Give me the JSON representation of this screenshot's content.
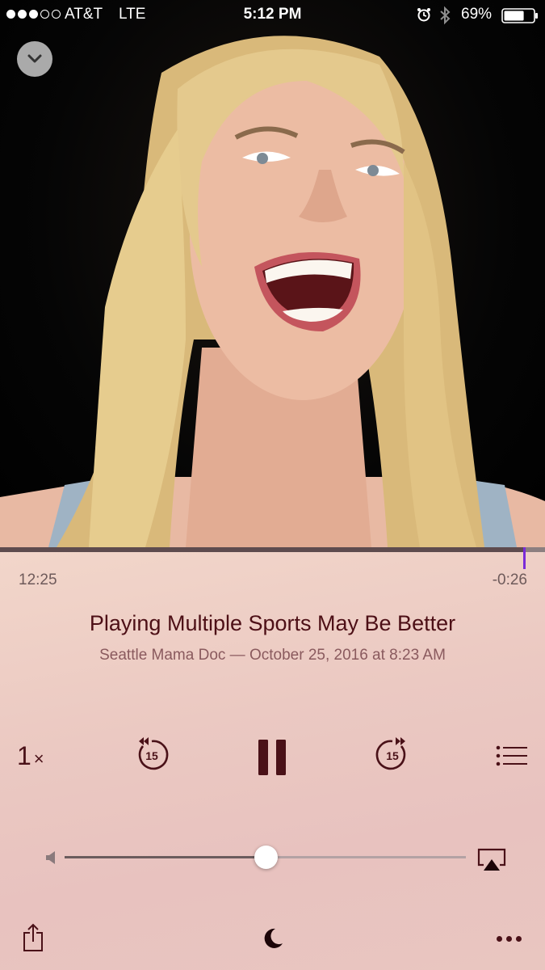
{
  "status_bar": {
    "signal_bars_filled": 3,
    "signal_bars_total": 5,
    "carrier": "AT&T",
    "network": "LTE",
    "time": "5:12 PM",
    "alarm_icon": "alarm-clock-icon",
    "bluetooth_icon": "bluetooth-icon",
    "battery_percent": "69%",
    "battery_level": 0.69
  },
  "artwork": {
    "description_icon": "podcast-artwork-image"
  },
  "player": {
    "progress_fraction": 0.963,
    "elapsed": "12:25",
    "remaining": "-0:26",
    "title": "Playing Multiple Sports May Be Better",
    "subtitle": "Seattle Mama Doc — October 25, 2016 at 8:23 AM",
    "speed_value": "1",
    "speed_suffix": "×",
    "skip_back_seconds": "15",
    "skip_forward_seconds": "15",
    "volume_fraction": 0.5,
    "colors": {
      "accent_playhead": "#7a2bd8",
      "title": "#4d0f16",
      "controls": "#4a1118"
    }
  }
}
